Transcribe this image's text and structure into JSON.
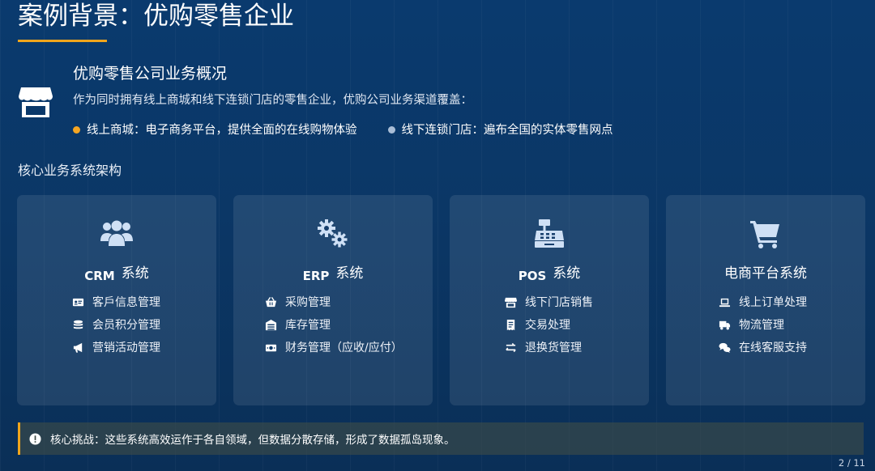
{
  "header": {
    "title": "案例背景：优购零售企业"
  },
  "overview": {
    "heading": "优购零售公司业务概况",
    "description": "作为同时拥有线上商城和线下连锁门店的零售企业，优购公司业务渠道覆盖：",
    "channels": [
      {
        "label": "线上商城：电子商务平台，提供全面的在线购物体验",
        "dot_color": "#f5a623"
      },
      {
        "label": "线下连锁门店：遍布全国的实体零售网点",
        "dot_color": "#a9bdd6"
      }
    ]
  },
  "section_label": "核心业务系统架构",
  "systems": [
    {
      "abbr": "CRM",
      "title": "系统",
      "icon": "users-icon",
      "items": [
        {
          "label": "客戶信息管理",
          "icon": "id-card-icon"
        },
        {
          "label": "会员积分管理",
          "icon": "coins-icon"
        },
        {
          "label": "营销活动管理",
          "icon": "megaphone-icon"
        }
      ]
    },
    {
      "abbr": "ERP",
      "title": "系统",
      "icon": "cogs-icon",
      "items": [
        {
          "label": "采购管理",
          "icon": "basket-icon"
        },
        {
          "label": "库存管理",
          "icon": "warehouse-icon"
        },
        {
          "label": "财务管理（应收/应付）",
          "icon": "money-icon"
        }
      ]
    },
    {
      "abbr": "POS",
      "title": "系统",
      "icon": "cash-register-icon",
      "items": [
        {
          "label": "线下门店销售",
          "icon": "store-icon"
        },
        {
          "label": "交易处理",
          "icon": "receipt-icon"
        },
        {
          "label": "退换货管理",
          "icon": "exchange-icon"
        }
      ]
    },
    {
      "abbr": "",
      "title": "电商平台系统",
      "icon": "shopping-cart-icon",
      "items": [
        {
          "label": "线上订单处理",
          "icon": "laptop-icon"
        },
        {
          "label": "物流管理",
          "icon": "truck-icon"
        },
        {
          "label": "在线客服支持",
          "icon": "chat-icon"
        }
      ]
    }
  ],
  "challenge": {
    "text": "核心挑战：这些系统高效运作于各自领域，但数据分散存储，形成了数据孤岛现象。",
    "icon": "exclamation-icon"
  },
  "footer": {
    "page": "2 / 11"
  },
  "colors": {
    "accent": "#f0a51c",
    "icon_light": "#cfe0f5",
    "background": "#0b3766"
  }
}
